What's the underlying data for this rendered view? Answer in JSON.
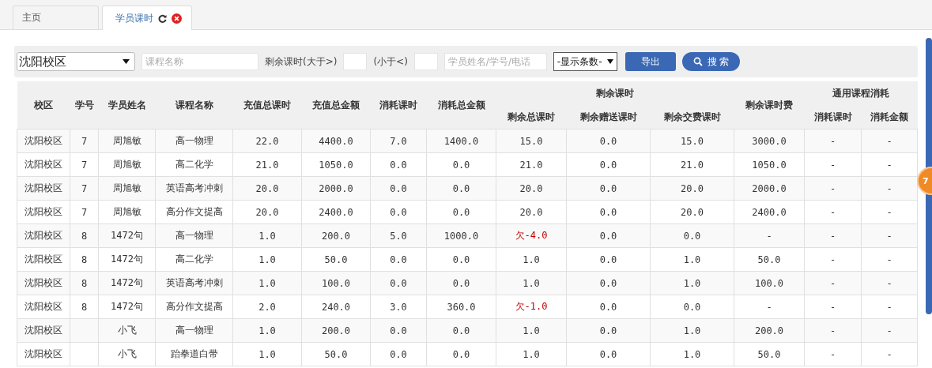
{
  "tabs": [
    {
      "label": "主页",
      "selected": false,
      "closable": false
    },
    {
      "label": "学员课时",
      "selected": true,
      "closable": true
    }
  ],
  "filters": {
    "campus": "沈阳校区",
    "course_placeholder": "课程名称",
    "remain_gt_label": "剩余课时(大于>)",
    "remain_lt_label": "(小于<)",
    "student_placeholder": "学员姓名/学号/电话",
    "page_size": "-显示条数-",
    "export_button": "导出",
    "search_button": "搜 索"
  },
  "table": {
    "columns": [
      {
        "label": "校区"
      },
      {
        "label": "学号"
      },
      {
        "label": "学员姓名"
      },
      {
        "label": "课程名称"
      },
      {
        "label": "充值总课时"
      },
      {
        "label": "充值总金额"
      },
      {
        "label": "消耗课时"
      },
      {
        "label": "消耗总金额"
      },
      {
        "label": "剩余课时",
        "colspan": 3,
        "children": [
          {
            "label": "剩余总课时"
          },
          {
            "label": "剩余赠送课时"
          },
          {
            "label": "剩余交费课时"
          }
        ]
      },
      {
        "label": "剩余课时费"
      },
      {
        "label": "通用课程消耗",
        "colspan": 2,
        "children": [
          {
            "label": "消耗课时"
          },
          {
            "label": "消耗金额"
          }
        ]
      }
    ],
    "rows": [
      {
        "cells": [
          "沈阳校区",
          "7",
          "周旭敏",
          "高一物理",
          "22.0",
          "4400.0",
          "7.0",
          "1400.0",
          "15.0",
          "0.0",
          "15.0",
          "3000.0",
          "-",
          "-"
        ],
        "owing": false
      },
      {
        "cells": [
          "沈阳校区",
          "7",
          "周旭敏",
          "高二化学",
          "21.0",
          "1050.0",
          "0.0",
          "0.0",
          "21.0",
          "0.0",
          "21.0",
          "1050.0",
          "-",
          "-"
        ],
        "owing": false
      },
      {
        "cells": [
          "沈阳校区",
          "7",
          "周旭敏",
          "英语高考冲刺",
          "20.0",
          "2000.0",
          "0.0",
          "0.0",
          "20.0",
          "0.0",
          "20.0",
          "2000.0",
          "-",
          "-"
        ],
        "owing": false
      },
      {
        "cells": [
          "沈阳校区",
          "7",
          "周旭敏",
          "高分作文提高",
          "20.0",
          "2400.0",
          "0.0",
          "0.0",
          "20.0",
          "0.0",
          "20.0",
          "2400.0",
          "-",
          "-"
        ],
        "owing": false
      },
      {
        "cells": [
          "沈阳校区",
          "8",
          "1472句",
          "高一物理",
          "1.0",
          "200.0",
          "5.0",
          "1000.0",
          "欠-4.0",
          "0.0",
          "0.0",
          "-",
          "-",
          "-"
        ],
        "owing": true
      },
      {
        "cells": [
          "沈阳校区",
          "8",
          "1472句",
          "高二化学",
          "1.0",
          "50.0",
          "0.0",
          "0.0",
          "1.0",
          "0.0",
          "1.0",
          "50.0",
          "-",
          "-"
        ],
        "owing": false
      },
      {
        "cells": [
          "沈阳校区",
          "8",
          "1472句",
          "英语高考冲刺",
          "1.0",
          "100.0",
          "0.0",
          "0.0",
          "1.0",
          "0.0",
          "1.0",
          "100.0",
          "-",
          "-"
        ],
        "owing": false
      },
      {
        "cells": [
          "沈阳校区",
          "8",
          "1472句",
          "高分作文提高",
          "2.0",
          "240.0",
          "3.0",
          "360.0",
          "欠-1.0",
          "0.0",
          "0.0",
          "-",
          "-",
          "-"
        ],
        "owing": true
      },
      {
        "cells": [
          "沈阳校区",
          "",
          "小飞",
          "高一物理",
          "1.0",
          "200.0",
          "0.0",
          "0.0",
          "1.0",
          "0.0",
          "1.0",
          "200.0",
          "-",
          "-"
        ],
        "owing": false
      },
      {
        "cells": [
          "沈阳校区",
          "",
          "小飞",
          "跆拳道白带",
          "1.0",
          "50.0",
          "0.0",
          "0.0",
          "1.0",
          "0.0",
          "1.0",
          "50.0",
          "-",
          "-"
        ],
        "owing": false
      }
    ]
  },
  "badge": "7"
}
